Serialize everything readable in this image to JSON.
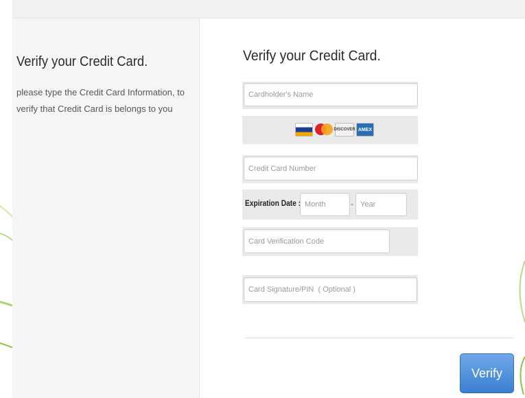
{
  "left_panel": {
    "title": "Verify your Credit Card.",
    "description": "please type the Credit Card Information, to verify that Credit Card is belongs to you"
  },
  "form": {
    "title": "Verify your Credit Card.",
    "cardholder_placeholder": "Cardholder's Name",
    "card_logos": [
      "VISA",
      "MasterCard",
      "DISCOVER",
      "AMEX"
    ],
    "card_number_placeholder": "Credit Card Number",
    "expiration_label": "Expiration Date :",
    "month_placeholder": "Month",
    "dash": "-",
    "year_placeholder": "Year",
    "cvc_placeholder": "Card Verification Code",
    "pin_placeholder": "Card Signature/PIN  ( Optional )",
    "verify_label": "Verify"
  },
  "colors": {
    "button_blue": "#3a7fd1",
    "decor_green": "#8cc63f"
  }
}
